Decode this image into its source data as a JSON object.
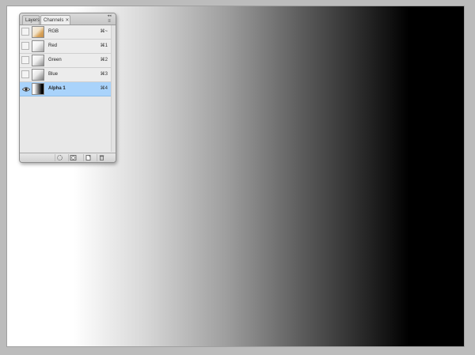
{
  "panel": {
    "tabs": [
      {
        "label": "Layers"
      },
      {
        "label": "Channels",
        "close": "✕"
      }
    ],
    "collapse_glyph": "◂◂",
    "menu_glyph": "≡",
    "channels": [
      {
        "name": "RGB",
        "shortcut": "⌘~",
        "visible": false
      },
      {
        "name": "Red",
        "shortcut": "⌘1",
        "visible": false
      },
      {
        "name": "Green",
        "shortcut": "⌘2",
        "visible": false
      },
      {
        "name": "Blue",
        "shortcut": "⌘3",
        "visible": false
      },
      {
        "name": "Alpha 1",
        "shortcut": "⌘4",
        "visible": true,
        "selected": true
      }
    ],
    "footer_buttons": [
      {
        "icon": "load-selection-icon"
      },
      {
        "icon": "save-selection-icon"
      },
      {
        "icon": "new-channel-icon"
      },
      {
        "icon": "trash-icon"
      }
    ]
  },
  "canvas": {
    "content": "horizontal-gradient-white-to-black",
    "colors": {
      "start": "#ffffff",
      "end": "#000000",
      "selection": "#a9d3fb"
    }
  }
}
